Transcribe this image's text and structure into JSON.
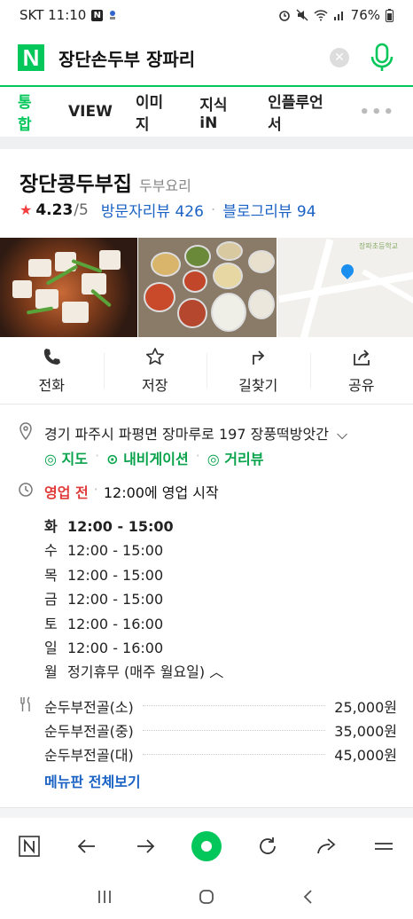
{
  "status_bar": {
    "carrier_time": "SKT 11:10",
    "battery": "76%"
  },
  "search": {
    "query": "장단손두부 장파리",
    "clear_icon": "close-icon",
    "mic_icon": "mic-icon",
    "brand_color": "#03c75a"
  },
  "tabs": [
    {
      "label": "통합",
      "active": true
    },
    {
      "label": "VIEW"
    },
    {
      "label": "이미지"
    },
    {
      "label": "지식iN"
    },
    {
      "label": "인플루언서"
    }
  ],
  "place": {
    "name": "장단콩두부집",
    "category": "두부요리",
    "rating": "4.23",
    "rating_max": "/5",
    "visitor_reviews": "방문자리뷰 426",
    "blog_reviews": "블로그리뷰 94"
  },
  "actions": [
    {
      "label": "전화",
      "icon": "phone-icon"
    },
    {
      "label": "저장",
      "icon": "star-icon"
    },
    {
      "label": "길찾기",
      "icon": "directions-icon"
    },
    {
      "label": "공유",
      "icon": "share-icon"
    }
  ],
  "info": {
    "address": "경기 파주시 파평면 장마루로 197 장풍떡방앗간",
    "nav_links": [
      "지도",
      "내비게이션",
      "거리뷰"
    ],
    "open_status": "영업 전",
    "open_note": "12:00에 영업 시작",
    "hours": [
      {
        "day": "화",
        "time": "12:00 - 15:00",
        "today": true
      },
      {
        "day": "수",
        "time": "12:00 - 15:00"
      },
      {
        "day": "목",
        "time": "12:00 - 15:00"
      },
      {
        "day": "금",
        "time": "12:00 - 15:00"
      },
      {
        "day": "토",
        "time": "12:00 - 16:00"
      },
      {
        "day": "일",
        "time": "12:00 - 16:00"
      },
      {
        "day": "월",
        "time": "정기휴무 (매주 월요일)"
      }
    ]
  },
  "menu": {
    "items": [
      {
        "name": "순두부전골(소)",
        "price": "25,000원"
      },
      {
        "name": "순두부전골(중)",
        "price": "35,000원"
      },
      {
        "name": "순두부전골(대)",
        "price": "45,000원"
      }
    ],
    "more": "메뉴판 전체보기"
  },
  "map": {
    "label": "장파초등학교"
  }
}
